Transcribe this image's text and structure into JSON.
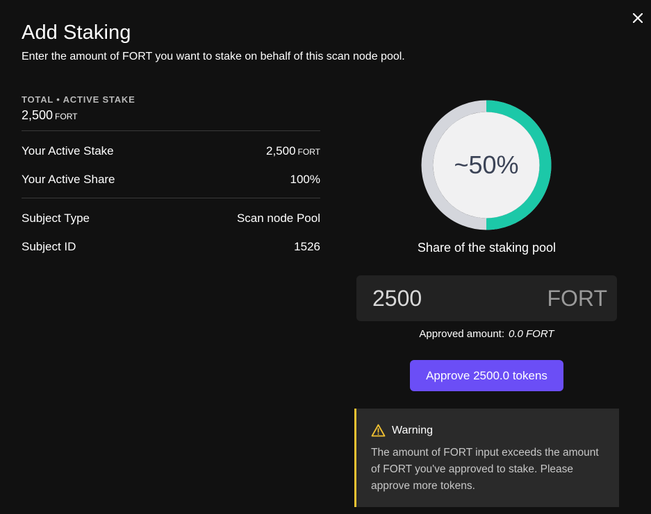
{
  "modal": {
    "title": "Add Staking",
    "subtitle": "Enter the amount of FORT you want to stake on behalf of this scan node pool."
  },
  "icons": {
    "close": "close-icon",
    "warning": "warning-triangle-icon"
  },
  "summary": {
    "total_label": "TOTAL • ACTIVE STAKE",
    "total_value": "2,500",
    "total_unit": "FORT"
  },
  "stats": [
    {
      "label": "Your Active Stake",
      "value": "2,500",
      "unit": "FORT"
    },
    {
      "label": "Your Active Share",
      "value": "100%"
    }
  ],
  "subject": [
    {
      "label": "Subject Type",
      "value": "Scan node Pool"
    },
    {
      "label": "Subject ID",
      "value": "1526"
    }
  ],
  "share": {
    "percent_text": "~50%",
    "fraction": 0.5,
    "caption": "Share of the staking pool",
    "colors": {
      "filled": "#1cc8a8",
      "track": "#d4d6dc",
      "inner": "#f1f1f2"
    }
  },
  "amount_input": {
    "value": "2500",
    "unit": "FORT"
  },
  "approved": {
    "label": "Approved amount:",
    "value": "0.0 FORT"
  },
  "approve_button": {
    "label": "Approve 2500.0 tokens",
    "color": "#6b4ef6"
  },
  "warning": {
    "title": "Warning",
    "message": "The amount of FORT input exceeds the amount of FORT you've approved to stake. Please approve more tokens.",
    "accent": "#f3c232"
  }
}
